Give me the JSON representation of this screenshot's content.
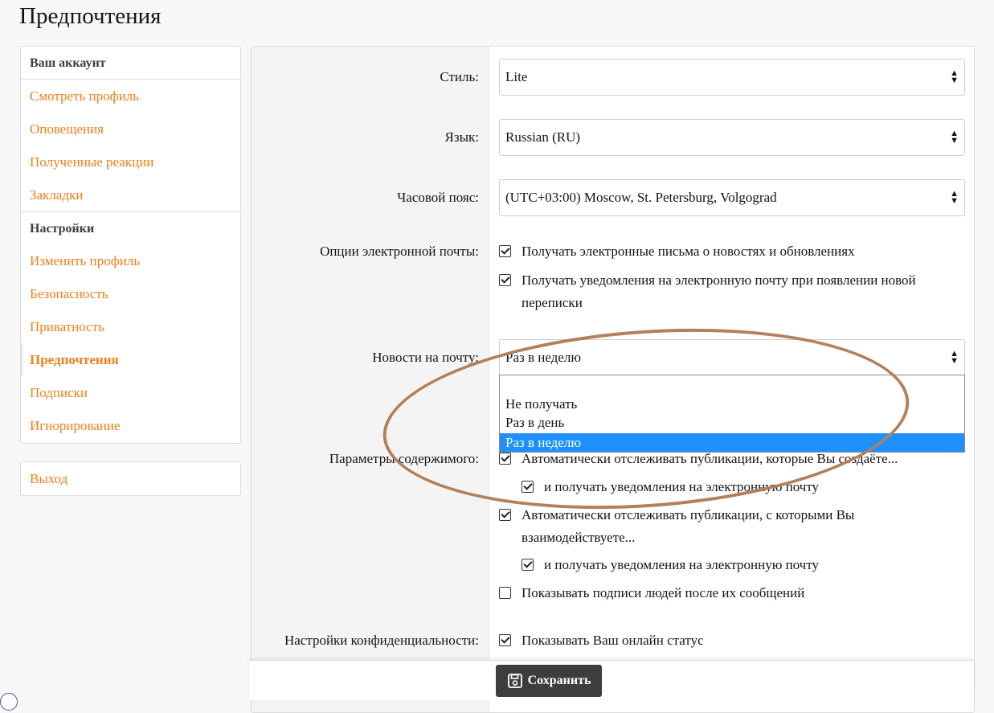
{
  "page": {
    "title": "Предпочтения"
  },
  "sidebar": {
    "account_heading": "Ваш аккаунт",
    "account_items": [
      {
        "label": "Смотреть профиль"
      },
      {
        "label": "Оповещения"
      },
      {
        "label": "Полученные реакции"
      },
      {
        "label": "Закладки"
      }
    ],
    "settings_heading": "Настройки",
    "settings_items": [
      {
        "label": "Изменить профиль"
      },
      {
        "label": "Безопасность"
      },
      {
        "label": "Приватность"
      },
      {
        "label": "Предпочтения",
        "active": true
      },
      {
        "label": "Подписки"
      },
      {
        "label": "Игнорирование"
      }
    ],
    "logout_label": "Выход"
  },
  "form": {
    "style": {
      "label": "Стиль:",
      "value": "Lite"
    },
    "language": {
      "label": "Язык:",
      "value": "Russian (RU)"
    },
    "timezone": {
      "label": "Часовой пояс:",
      "value": "(UTC+03:00) Moscow, St. Petersburg, Volgograd"
    },
    "email_options": {
      "label": "Опции электронной почты:",
      "opt1": {
        "text": "Получать электронные письма о новостях и обновлениях",
        "checked": true
      },
      "opt2": {
        "text_line1": "Получать уведомления на электронную почту при появлении новой",
        "text_line2": "переписки",
        "checked": true
      }
    },
    "news": {
      "label": "Новости на почту:",
      "value": "Раз в неделю",
      "options": [
        "Не получать",
        "Раз в день",
        "Раз в неделю"
      ],
      "selected_index": 2
    },
    "content": {
      "label": "Параметры содержимого:",
      "opt1": {
        "text": "Автоматически отслеживать публикации, которые Вы создаёте...",
        "checked": true
      },
      "opt1_sub": {
        "text": "и получать уведомления на электронную почту",
        "checked": true
      },
      "opt2": {
        "text_line1": "Автоматически отслеживать публикации, с которыми Вы",
        "text_line2": "взаимодействуете...",
        "checked": true
      },
      "opt2_sub": {
        "text": "и получать уведомления на электронную почту",
        "checked": true
      },
      "opt3": {
        "text": "Показывать подписи людей после их сообщений",
        "checked": false
      }
    },
    "privacy": {
      "label": "Настройки конфиденциальности:",
      "opt1": {
        "text": "Показывать Ваш онлайн статус",
        "checked": true
      }
    }
  },
  "actions": {
    "save_label": "Сохранить"
  },
  "colors": {
    "link": "#ef7f1a",
    "highlight": "#1e90ff",
    "annotation": "#b4805a",
    "button": "#3d3d3d"
  },
  "icons": {
    "save": "floppy-disk-icon",
    "select_arrows": "up-down-arrows-icon"
  }
}
